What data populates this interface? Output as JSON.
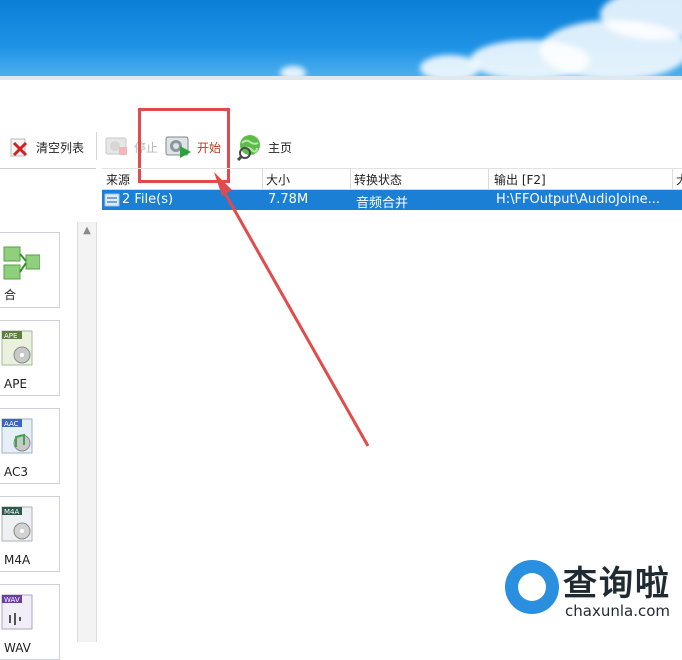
{
  "toolbar": {
    "clear_list": "清空列表",
    "stop": "停止",
    "start": "开始",
    "home": "主页"
  },
  "table": {
    "columns": [
      "来源",
      "大小",
      "转换状态",
      "输出 [F2]",
      "大"
    ],
    "rows": [
      {
        "source": "2 File(s)",
        "size": "7.78M",
        "status": "音频合并",
        "output": "H:\\FFOutput\\AudioJoine..."
      }
    ]
  },
  "formats": [
    {
      "label": "合",
      "icon": "audio-joiner-icon"
    },
    {
      "label": "APE",
      "icon": "ape-format-icon"
    },
    {
      "label": "AC3",
      "icon": "aac-format-icon"
    },
    {
      "label": "M4A",
      "icon": "m4a-format-icon"
    },
    {
      "label": "WAV",
      "icon": "wav-format-icon"
    }
  ],
  "format_badges": {
    "ape": "APE",
    "aac": "AAC",
    "m4a": "M4A",
    "wav": "WAV"
  },
  "watermark": {
    "text": "查询啦",
    "url": "chaxunla.com"
  },
  "colors": {
    "selection": "#1c7fd6",
    "highlight": "#e24b4b",
    "sky": "#0b7fd6"
  }
}
